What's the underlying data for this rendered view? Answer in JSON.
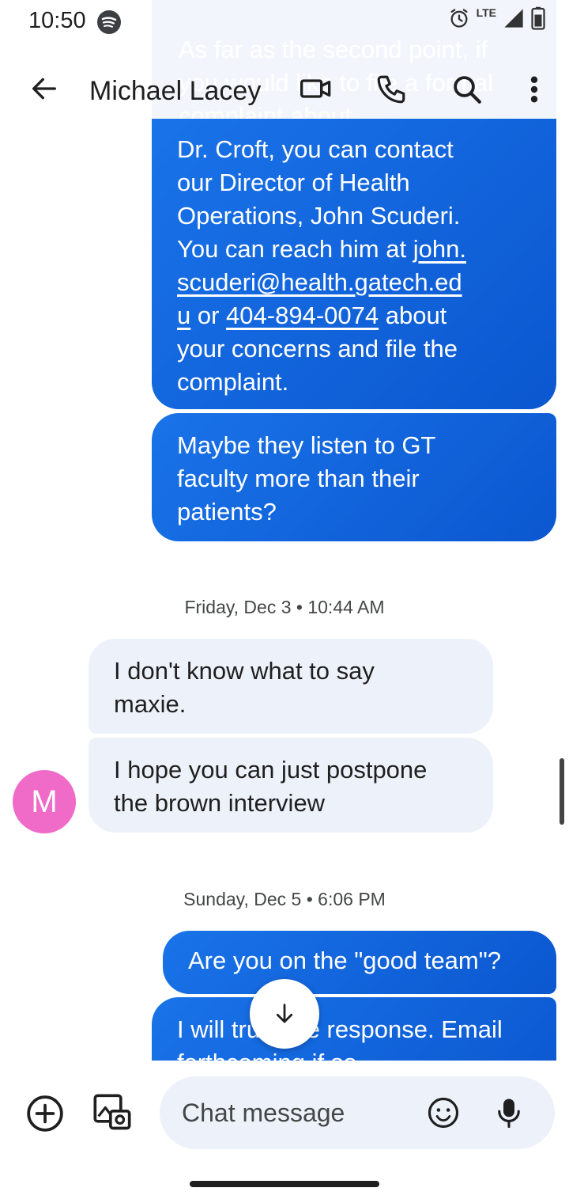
{
  "status_bar": {
    "time": "10:50",
    "network": "LTE"
  },
  "header": {
    "contact_name": "Michael Lacey"
  },
  "conversation": {
    "faded_message": "As far as the second point, if you would like to file a formal complaint about",
    "msg1": {
      "line1": "Dr. Croft, you can contact",
      "line2": "our Director of Health",
      "line3": "Operations, John Scuderi.",
      "line4_a": "You can reach him at ",
      "email_a": "john.",
      "email_b": "scuderi@health.gatech.ed",
      "email_c": "u",
      "line6_mid": " or ",
      "phone": "404-894-0074",
      "line6_end": " about",
      "line7": "your concerns and file the",
      "line8": "complaint."
    },
    "msg2": {
      "line1": "Maybe they listen to GT",
      "line2": "faculty more than their",
      "line3": "patients?"
    },
    "date1": "Friday, Dec 3 • 10:44 AM",
    "in1": {
      "line1": "I don't know what to say",
      "line2": "maxie."
    },
    "in2": {
      "line1": "I hope you can just postpone",
      "line2": "the brown interview"
    },
    "avatar_letter": "M",
    "date2": "Sunday, Dec 5 • 6:06 PM",
    "out3": "Are you on the \"good team\"?",
    "out4": {
      "line1": "I will trust the response. Email",
      "line2": "forthcoming if so..."
    }
  },
  "composer": {
    "placeholder": "Chat message"
  },
  "colors": {
    "outgoing_bubble": "#1a73e8",
    "incoming_bubble": "#edf2fa",
    "avatar": "#f06ac8"
  }
}
